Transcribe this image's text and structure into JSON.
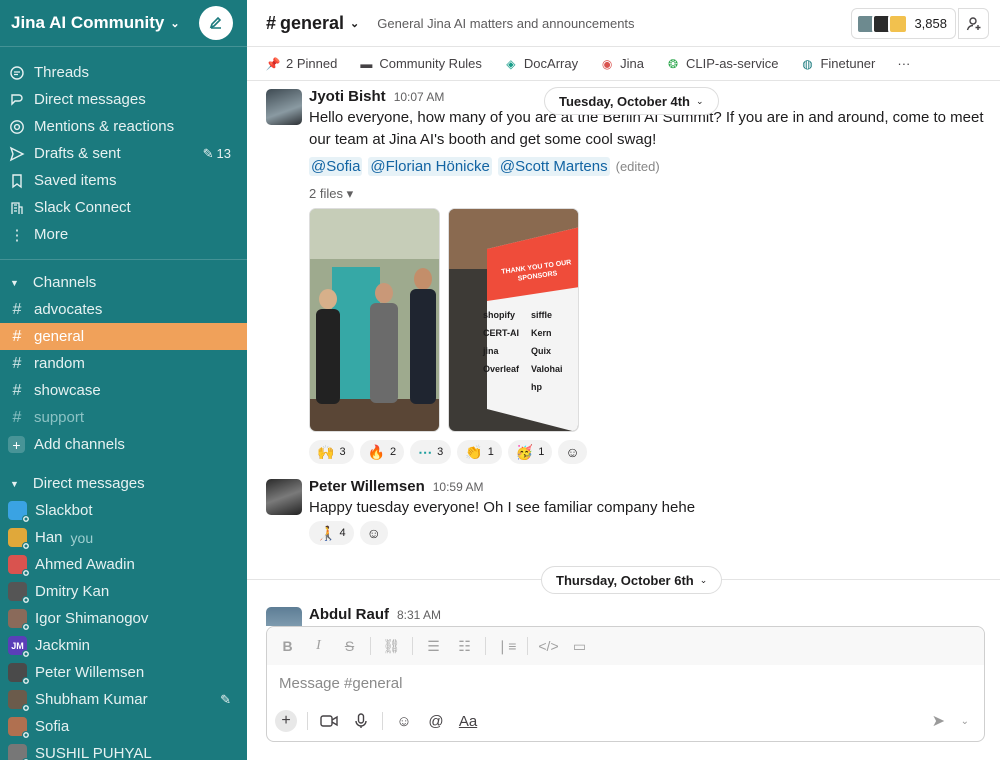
{
  "workspace": {
    "name": "Jina AI Community"
  },
  "nav": [
    {
      "label": "Threads",
      "icon": "threads-icon"
    },
    {
      "label": "Direct messages",
      "icon": "dm-icon"
    },
    {
      "label": "Mentions & reactions",
      "icon": "at-icon"
    },
    {
      "label": "Drafts & sent",
      "icon": "send-icon",
      "count": "13"
    },
    {
      "label": "Saved items",
      "icon": "bookmark-icon"
    },
    {
      "label": "Slack Connect",
      "icon": "building-icon"
    },
    {
      "label": "More",
      "icon": "more-icon"
    }
  ],
  "channels_section": "Channels",
  "channels": [
    {
      "name": "advocates",
      "state": "normal"
    },
    {
      "name": "general",
      "state": "active"
    },
    {
      "name": "random",
      "state": "normal"
    },
    {
      "name": "showcase",
      "state": "normal"
    },
    {
      "name": "support",
      "state": "muted"
    }
  ],
  "add_channels": "Add channels",
  "dm_section": "Direct messages",
  "dms": [
    {
      "name": "Slackbot",
      "color": "#3aa3e3"
    },
    {
      "name": "Han",
      "you": "you",
      "color": "#e0a83a"
    },
    {
      "name": "Ahmed Awadin",
      "color": "#d9534f"
    },
    {
      "name": "Dmitry Kan",
      "color": "#555555"
    },
    {
      "name": "Igor Shimanogov",
      "color": "#8a6a5a"
    },
    {
      "name": "Jackmin",
      "initials": "JM",
      "color": "#5a3fb8"
    },
    {
      "name": "Peter Willemsen",
      "color": "#4a4a4a"
    },
    {
      "name": "Shubham Kumar",
      "color": "#6b5b4b",
      "edit": true
    },
    {
      "name": "Sofia",
      "color": "#b07050"
    },
    {
      "name": "SUSHIL PUHYAL",
      "color": "#777777"
    }
  ],
  "channel": {
    "name": "general",
    "topic": "General Jina AI matters and announcements",
    "member_count": "3,858"
  },
  "bookmarks": [
    {
      "label": "2 Pinned",
      "icon": "pin-icon"
    },
    {
      "label": "Community Rules",
      "icon": "doc-icon"
    },
    {
      "label": "DocArray",
      "icon": "docarray-icon"
    },
    {
      "label": "Jina",
      "icon": "jina-icon"
    },
    {
      "label": "CLIP-as-service",
      "icon": "clip-icon"
    },
    {
      "label": "Finetuner",
      "icon": "finetuner-icon"
    }
  ],
  "messages": [
    {
      "author": "Jyoti Bisht",
      "time": "10:07 AM",
      "text": "Hello everyone, how many of you are at the Berlin AI Summit? If you are in and around, come to meet our team at Jina AI's booth and get some cool swag!",
      "mentions": [
        "@Sofia",
        "@Florian Hönicke",
        "@Scott Martens"
      ],
      "edited": "(edited)",
      "files_label": "2 files",
      "sign": {
        "header": "THANK YOU TO OUR SPONSORS",
        "sponsors": [
          "shopify",
          "siffle",
          "Kern",
          "CERT-AI",
          "jina",
          "Quix",
          "Overleaf",
          "Valohai",
          "hp"
        ]
      },
      "reactions": [
        {
          "emoji": "🙌",
          "count": "3"
        },
        {
          "emoji": "🔥",
          "count": "2"
        },
        {
          "emoji": "⋯",
          "count": "3"
        },
        {
          "emoji": "👏",
          "count": "1"
        },
        {
          "emoji": "🥳",
          "count": "1"
        }
      ]
    },
    {
      "author": "Peter Willemsen",
      "time": "10:59 AM",
      "text": "Happy tuesday everyone! Oh I see familiar company hehe",
      "reactions": [
        {
          "emoji": "🧑‍🦯",
          "count": "4"
        }
      ]
    },
    {
      "author": "Abdul Rauf",
      "time": "8:31 AM"
    }
  ],
  "dates": [
    "Tuesday, October 4th",
    "Thursday, October 6th"
  ],
  "composer": {
    "placeholder": "Message #general"
  },
  "colors": {
    "sidebar": "#1b7a7e",
    "active_channel": "#f0a15a",
    "mention_text": "#1264a3"
  }
}
